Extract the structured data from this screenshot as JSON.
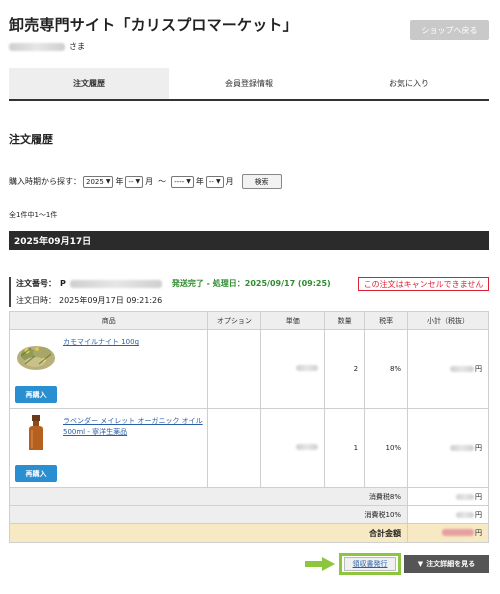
{
  "header": {
    "site_title": "卸売専門サイト「カリスプロマーケット」",
    "user_suffix": "さま",
    "back_button": "ショップへ戻る"
  },
  "tabs": [
    {
      "label": "注文履歴",
      "active": true
    },
    {
      "label": "会員登録情報",
      "active": false
    },
    {
      "label": "お気に入り",
      "active": false
    }
  ],
  "section_title": "注文履歴",
  "search": {
    "label": "購入時期から探す：",
    "year_from": "2025",
    "year_unit": "年",
    "month_from": "--",
    "month_unit": "月",
    "range_sep": "〜",
    "year_to": "----",
    "month_to": "--",
    "button": "検索"
  },
  "result_count": "全1件中1〜1件",
  "date_header": "2025年09月17日",
  "order": {
    "number_label": "注文番号：",
    "number_prefix": "P",
    "status": "発送完了 - 処理日：2025/09/17 (09:25)",
    "date_label": "注文日時：",
    "date_value": "2025年09月17日 09:21:26",
    "cancel_note": "この注文はキャンセルできません"
  },
  "table": {
    "headers": [
      "商品",
      "オプション",
      "単価",
      "数量",
      "税率",
      "小計（税抜）"
    ],
    "rows": [
      {
        "product": "カモマイルナイト 100g",
        "option": "",
        "qty": "2",
        "tax": "8%",
        "rebuy": "再購入",
        "thumb_icon": "dried-herb-icon"
      },
      {
        "product": "ラベンダー メイレット オーガニック オイル 500ml - 寧洋生薬品",
        "option": "",
        "qty": "1",
        "tax": "10%",
        "rebuy": "再購入",
        "thumb_icon": "amber-bottle-icon"
      }
    ],
    "tax8_label": "消費税8%",
    "tax10_label": "消費税10%",
    "total_label": "合計金額",
    "yen": "円"
  },
  "actions": {
    "receipt_button": "領収書発行",
    "detail_button": "注文詳細を見る",
    "detail_icon": "▼"
  },
  "colors": {
    "status_green": "#2f8c2f",
    "cancel_red": "#dd2233",
    "rebuy_blue": "#2a8fd0",
    "highlight_green": "#8cc63f",
    "total_bg": "#f7e9c4"
  }
}
